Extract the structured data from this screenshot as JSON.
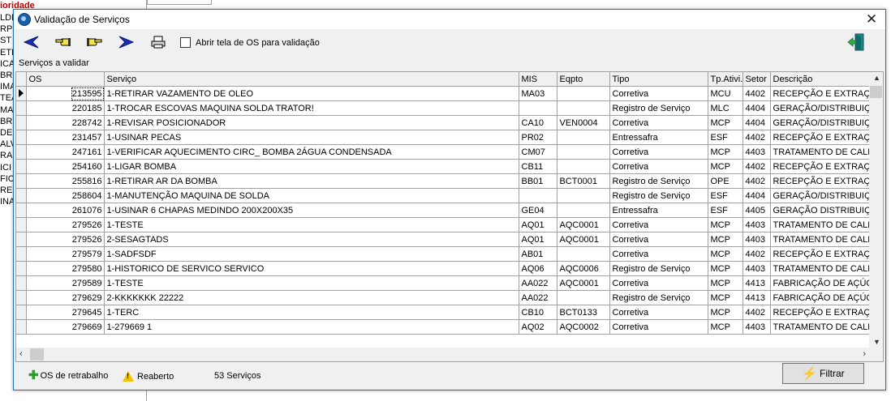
{
  "background": {
    "heading": "ioridade",
    "left_column_fragments": [
      "LDI",
      "RP",
      "ST",
      "ETI",
      "ICA",
      "BRI",
      "IMA",
      "TEA",
      "MAN",
      "BR",
      "DEN",
      "ALV",
      "RA",
      "ICI",
      "FIC",
      "RES",
      "INA"
    ]
  },
  "window": {
    "title": "Validação de Serviços",
    "close_glyph": "✕"
  },
  "toolbar": {
    "checkbox_label": "Abrir tela de OS para validação",
    "checkbox_checked": false,
    "icons": [
      "arrow-first-icon",
      "hand-left-icon",
      "hand-right-icon",
      "arrow-last-icon",
      "printer-icon"
    ],
    "exit_icon": "exit-door-icon"
  },
  "grid": {
    "section_label": "Serviços a validar",
    "columns": [
      "OS",
      "Serviço",
      "MIS",
      "Eqpto",
      "Tipo",
      "Tp.Ativi.",
      "Setor",
      "Descrição"
    ],
    "rows": [
      [
        "213595",
        "1-RETIRAR VAZAMENTO DE OLEO",
        "MA03",
        "",
        "Corretiva",
        "MCU",
        "4402",
        "RECEPÇÃO E EXTRAÇÃO"
      ],
      [
        "220185",
        "1-TROCAR ESCOVAS MAQUINA SOLDA TRATOR!",
        "",
        "",
        "Registro de Serviço",
        "MLC",
        "4404",
        "GERAÇÃO/DISTRIBUIÇÃO"
      ],
      [
        "228742",
        "1-REVISAR POSICIONADOR",
        "CA10",
        "VEN0004",
        "Corretiva",
        "MCP",
        "4404",
        "GERAÇÃO/DISTRIBUIÇÃO"
      ],
      [
        "231457",
        "1-USINAR PECAS",
        "PR02",
        "",
        "Entressafra",
        "ESF",
        "4402",
        "RECEPÇÃO E EXTRAÇÃO"
      ],
      [
        "247161",
        "1-VERIFICAR AQUECIMENTO CIRC_ BOMBA 2ÁGUA CONDENSADA",
        "CM07",
        "",
        "Corretiva",
        "MCP",
        "4403",
        "TRATAMENTO DE CALDO"
      ],
      [
        "254160",
        "1-LIGAR BOMBA",
        "CB11",
        "",
        "Corretiva",
        "MCP",
        "4402",
        "RECEPÇÃO E EXTRAÇÃO"
      ],
      [
        "255816",
        "1-RETIRAR AR DA BOMBA",
        "BB01",
        "BCT0001",
        "Registro de Serviço",
        "OPE",
        "4402",
        "RECEPÇÃO E EXTRAÇÃO"
      ],
      [
        "258604",
        "1-MANUTENÇÃO MAQUINA DE SOLDA",
        "",
        "",
        "Registro de Serviço",
        "ESF",
        "4404",
        "GERAÇÃO/DISTRIBUIÇÃO"
      ],
      [
        "261076",
        "1-USINAR 6 CHAPAS MEDINDO 200X200X35",
        "GE04",
        "",
        "Entressafra",
        "ESF",
        "4405",
        "GERAÇÃO DISTRIBUIÇÃO"
      ],
      [
        "279526",
        "1-TESTE",
        "AQ01",
        "AQC0001",
        "Corretiva",
        "MCP",
        "4403",
        "TRATAMENTO DE CALDO"
      ],
      [
        "279526",
        "2-SESAGTADS",
        "AQ01",
        "AQC0001",
        "Corretiva",
        "MCP",
        "4403",
        "TRATAMENTO DE CALDO"
      ],
      [
        "279579",
        "1-SADFSDF",
        "AB01",
        "",
        "Corretiva",
        "MCP",
        "4402",
        "RECEPÇÃO E EXTRAÇÃO"
      ],
      [
        "279580",
        "1-HISTORICO DE SERVICO SERVICO",
        "AQ06",
        "AQC0006",
        "Registro de Serviço",
        "MCP",
        "4403",
        "TRATAMENTO DE CALDO"
      ],
      [
        "279589",
        "1-TESTE",
        "AA022",
        "AQC0001",
        "Corretiva",
        "MCP",
        "4413",
        "FABRICAÇÃO DE AÇÚCAR"
      ],
      [
        "279629",
        "2-KKKKKKK 22222",
        "AA022",
        "",
        "Registro de Serviço",
        "MCP",
        "4413",
        "FABRICAÇÃO DE AÇÚCAR"
      ],
      [
        "279645",
        "1-TERC",
        "CB10",
        "BCT0133",
        "Corretiva",
        "MCP",
        "4402",
        "RECEPÇÃO E EXTRAÇÃO"
      ],
      [
        "279669",
        "1-279669 1",
        "AQ02",
        "AQC0002",
        "Corretiva",
        "MCP",
        "4403",
        "TRATAMENTO DE CALDO"
      ]
    ]
  },
  "footer": {
    "retrabalho_label": "OS de retrabalho",
    "reaberto_label": "Reaberto",
    "count_label": "53 Serviços",
    "filter_label": "Filtrar"
  }
}
